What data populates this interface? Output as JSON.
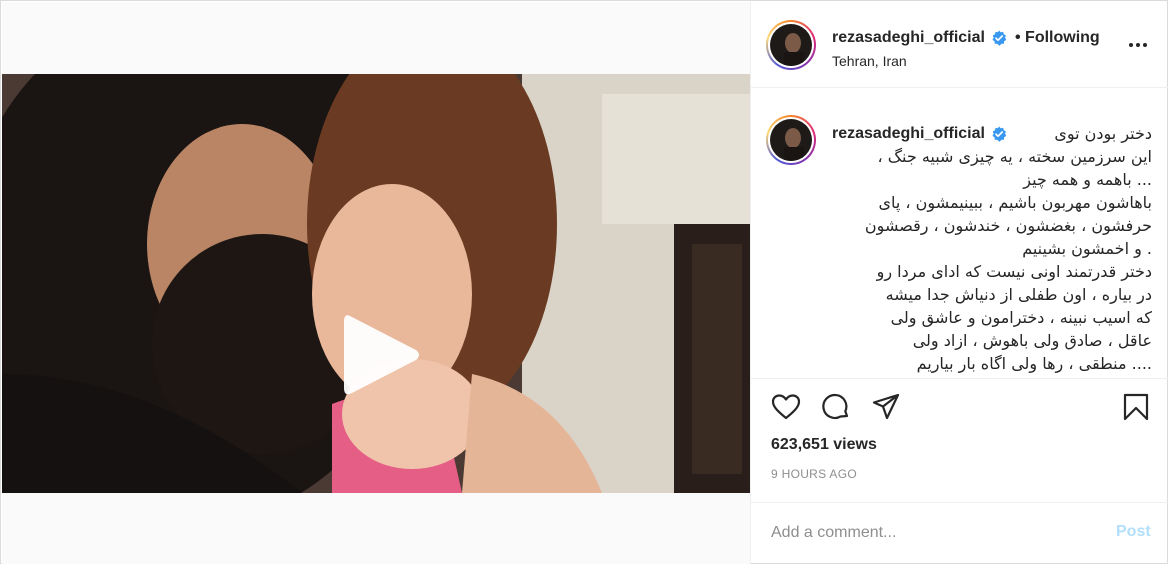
{
  "post": {
    "username": "rezasadeghi_official",
    "follow_status": "• Following",
    "location": "Tehran, Iran",
    "caption_lines": "دختر بودن توی\nاین سرزمین سخته ، یه چیزی شبیه جنگ ،\n... باهمه و همه چیز\nباهاشون مهربون باشیم ، ببینیمشون ، پای\nحرفشون ، بغضشون ، خندشون ، رقصشون\n. و اخمشون بشینیم\nدختر قدرتمند اونی نیست که ادای مردا رو\nدر بیاره ، اون طفلی از دنیاش جدا میشه\nکه اسیب نبینه ، دخترامون و عاشق ولی\nعاقل ، صادق ولی باهوش ، ازاد ولی\n.... منطقی ، رها ولی اگاه بار بیاریم",
    "views": "623,651 views",
    "time_ago": "9 HOURS AGO"
  },
  "comment": {
    "placeholder": "Add a comment...",
    "post_label": "Post"
  },
  "icons": {
    "verified": "verified-badge-icon",
    "more": "more-options-icon",
    "like": "heart-icon",
    "comment": "comment-bubble-icon",
    "share": "paper-plane-icon",
    "save": "bookmark-icon",
    "play": "play-icon",
    "tagged": "user-tag-icon"
  },
  "colors": {
    "verified": "#3897f0",
    "post_disabled": "#b2dffc",
    "muted": "#8e8e8e"
  }
}
